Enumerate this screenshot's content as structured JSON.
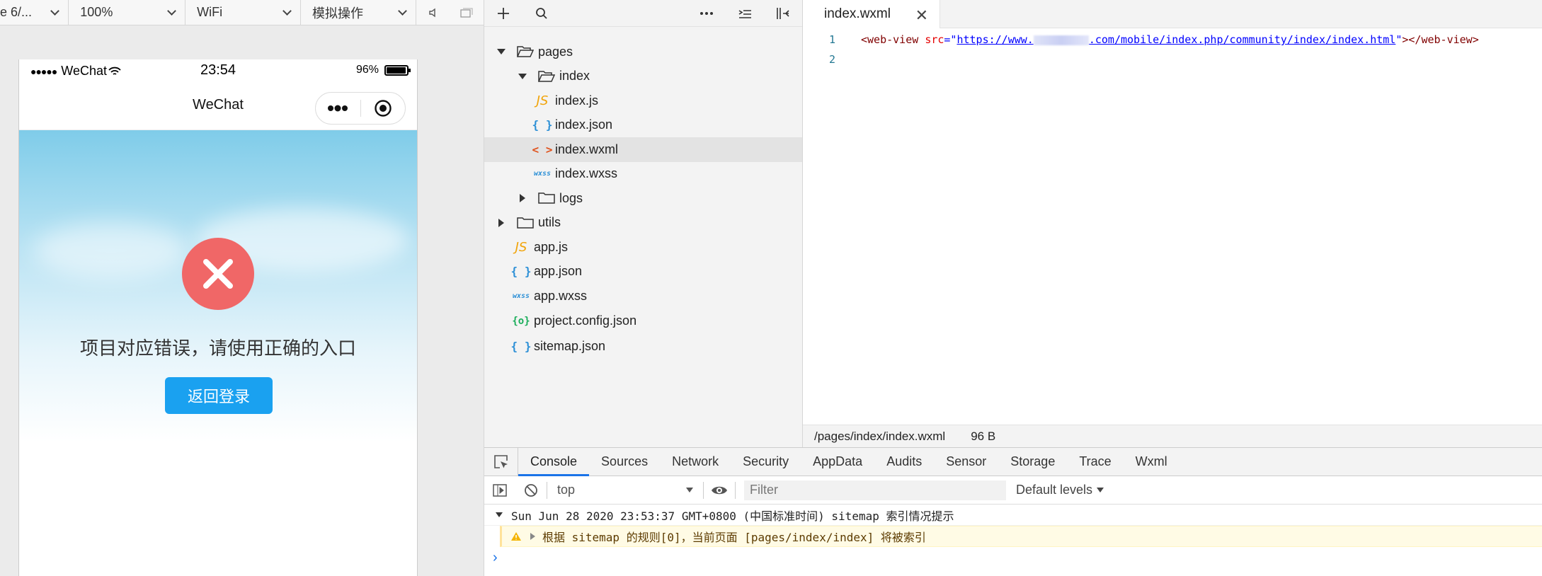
{
  "simulator": {
    "toolbar": {
      "device": "e 6/...",
      "zoom": "100%",
      "network": "WiFi",
      "operation": "模拟操作"
    },
    "status_bar": {
      "carrier": "WeChat",
      "time": "23:54",
      "battery": "96%",
      "battery_level": 0.96
    },
    "nav_bar": {
      "title": "WeChat"
    },
    "page": {
      "error_message": "项目对应错误，请使用正确的入口",
      "button_label": "返回登录",
      "error_color": "#f06767",
      "button_color": "#1aa1f0"
    }
  },
  "file_tree": {
    "items": [
      {
        "label": "pages",
        "type": "folder",
        "expanded": true
      },
      {
        "label": "index",
        "type": "folder",
        "expanded": true
      },
      {
        "label": "index.js",
        "type": "js",
        "icon_text": "JS"
      },
      {
        "label": "index.json",
        "type": "json",
        "icon_text": "{ }"
      },
      {
        "label": "index.wxml",
        "type": "wxml",
        "icon_text": "< >",
        "selected": true
      },
      {
        "label": "index.wxss",
        "type": "wxss",
        "icon_text": "wxss"
      },
      {
        "label": "logs",
        "type": "folder",
        "expanded": false
      },
      {
        "label": "utils",
        "type": "folder",
        "expanded": false
      },
      {
        "label": "app.js",
        "type": "js",
        "icon_text": "JS"
      },
      {
        "label": "app.json",
        "type": "json",
        "icon_text": "{ }"
      },
      {
        "label": "app.wxss",
        "type": "wxss",
        "icon_text": "wxss"
      },
      {
        "label": "project.config.json",
        "type": "cfg",
        "icon_text": "{o}"
      },
      {
        "label": "sitemap.json",
        "type": "json",
        "icon_text": "{ }"
      }
    ]
  },
  "editor": {
    "tab_label": "index.wxml",
    "close_glyph": "✕",
    "lines": {
      "n1": "1",
      "n2": "2",
      "tag_open": "<web-view",
      "attr": "src",
      "eq": "=\"",
      "url_prefix": "https://www.",
      "url_suffix": ".com/mobile/index.php/community/index/index.html",
      "quote_close": "\"",
      "tag_close": "></web-view>"
    },
    "status": {
      "path": "/pages/index/index.wxml",
      "size": "96 B"
    }
  },
  "devtools": {
    "tabs": [
      "Console",
      "Sources",
      "Network",
      "Security",
      "AppData",
      "Audits",
      "Sensor",
      "Storage",
      "Trace",
      "Wxml"
    ],
    "active_tab": "Console",
    "context": "top",
    "filter_placeholder": "Filter",
    "levels": "Default levels",
    "log_group": "Sun Jun 28 2020 23:53:37 GMT+0800 (中国标准时间) sitemap 索引情况提示",
    "warning": "根据 sitemap 的规则[0]，当前页面 [pages/index/index] 将被索引",
    "prompt": "›"
  }
}
